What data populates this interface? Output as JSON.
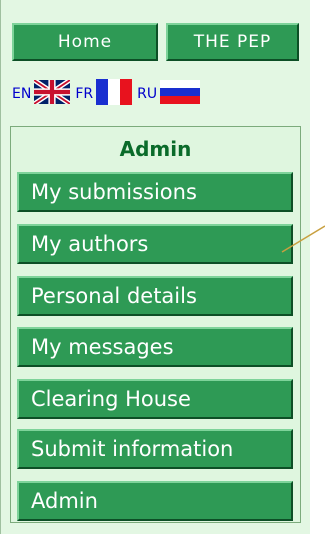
{
  "nav": {
    "home_label": "Home",
    "pep_label": "THE PEP"
  },
  "languages": [
    {
      "code": "EN",
      "flag": "uk-flag-icon"
    },
    {
      "code": "FR",
      "flag": "france-flag-icon"
    },
    {
      "code": "RU",
      "flag": "russia-flag-icon"
    }
  ],
  "menu": {
    "title": "Admin",
    "items": [
      {
        "label": "My submissions"
      },
      {
        "label": "My authors"
      },
      {
        "label": "Personal details"
      },
      {
        "label": "My messages"
      },
      {
        "label": "Clearing House"
      },
      {
        "label": "Submit information"
      },
      {
        "label": "Admin"
      }
    ]
  },
  "colors": {
    "button_green": "#2e9a55",
    "panel_bg": "#e3f7e3",
    "title_green": "#0a6b2a",
    "link_blue": "#0000cc"
  }
}
